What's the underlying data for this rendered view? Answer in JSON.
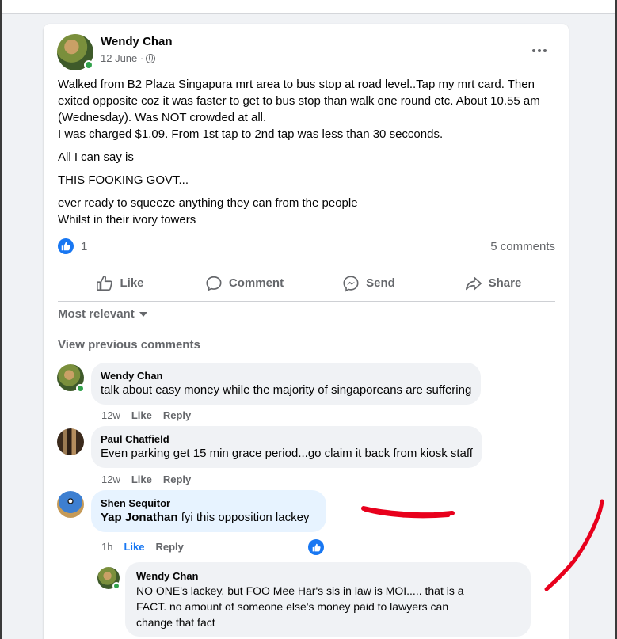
{
  "post": {
    "author": "Wendy Chan",
    "date": "12 June ·",
    "privacy_icon": "globe-icon",
    "body": [
      "Walked from B2 Plaza Singapura mrt area  to bus stop at road level..Tap my mrt card. Then exited opposite coz it was faster to get to bus stop than walk one round  etc. About 10.55 am (Wednesday). Was NOT crowded at all.\nI was charged $1.09. From 1st tap to 2nd tap was less than 30 secconds.",
      "All I can say is",
      "THIS FOOKING GOVT...",
      "ever ready to squeeze anything they can from the people\nWhilst in their  ivory towers"
    ],
    "reaction_count": "1",
    "comments_count": "5 comments"
  },
  "actions": {
    "like": "Like",
    "comment": "Comment",
    "send": "Send",
    "share": "Share"
  },
  "comments_section": {
    "sort_label": "Most relevant",
    "view_previous": "View previous comments",
    "comments": [
      {
        "name": "Wendy Chan",
        "text": "talk about easy money while the majority of singaporeans are suffering",
        "time": "12w",
        "like": "Like",
        "reply": "Reply"
      },
      {
        "name": "Paul Chatfield",
        "text": "Even parking get 15 min grace period...go claim it back from kiosk staff",
        "time": "12w",
        "like": "Like",
        "reply": "Reply"
      },
      {
        "name": "Shen Sequitor",
        "tag": "Yap Jonathan",
        "text": " fyi this opposition lackey",
        "time": "1h",
        "like": "Like",
        "reply": "Reply"
      },
      {
        "name": "Wendy Chan",
        "text": "NO ONE's lackey. but FOO Mee Har's sis in law is MOI..... that is a\nFACT. no amount of someone else's money paid to lawyers can\nchange that fact"
      }
    ]
  },
  "colors": {
    "accent": "#1877f2",
    "online": "#31a24c",
    "annotation": "#e8001c"
  }
}
